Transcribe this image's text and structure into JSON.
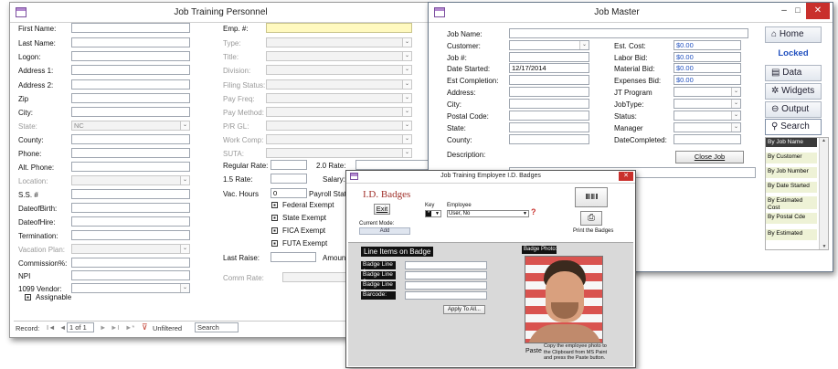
{
  "personnel": {
    "title": "Job Training Personnel",
    "left_labels": [
      "First Name:",
      "Last Name:",
      "Logon:",
      "Address 1:",
      "Address 2:",
      "Zip",
      "City:",
      "State:",
      "County:",
      "Phone:",
      "Alt. Phone:",
      "Location:",
      "S.S. #",
      "DateofBirth:",
      "DateofHire:",
      "Termination:",
      "Vacation Plan:",
      "Commission%:",
      "NPI",
      "1099 Vendor:"
    ],
    "state_value": "NC",
    "assignable_label": "Assignable",
    "mid_labels": [
      "Emp. #:",
      "Type:",
      "Title:",
      "Division:",
      "Filing Status:",
      "Pay Freq:",
      "Pay Method:",
      "P/R GL:",
      "Work Comp:",
      "SUTA:"
    ],
    "regular_rate": "Regular Rate:",
    "rate_20": "2.0 Rate:",
    "rate_15": "1.5 Rate:",
    "salary": "Salary:",
    "vac_hours": "Vac. Hours",
    "vac_value": "0",
    "payroll_status": "Payroll Status",
    "federal_exempt": "Federal Exempt",
    "state_exempt": "State Exempt",
    "fica_exempt": "FICA Exempt",
    "futa_exempt": "FUTA Exempt",
    "last_raise": "Last Raise:",
    "amount": "Amount",
    "comm_rate": "Comm Rate:",
    "record_label": "Record:",
    "record_value": "1 of 1",
    "unfiltered": "Unfiltered",
    "search": "Search"
  },
  "job_master": {
    "title": "Job Master",
    "left_labels": [
      "Job Name:",
      "Customer:",
      "Job #:",
      "Date Started:",
      "Est Completion:",
      "Address:",
      "City:",
      "Postal Code:",
      "State:",
      "County:",
      "Description:"
    ],
    "date_started": "12/17/2014",
    "right_labels": [
      "Est. Cost:",
      "Labor Bid:",
      "Material Bid:",
      "Expenses Bid:",
      "JT Program",
      "JobType:",
      "Status:",
      "Manager",
      "DateCompleted:"
    ],
    "money": [
      "$0.00",
      "$0.00",
      "$0.00",
      "$0.00"
    ],
    "close_job": "Close Job",
    "nav": {
      "home": "Home",
      "locked": "Locked",
      "data": "Data",
      "widgets": "Widgets",
      "output": "Output",
      "search": "Search"
    },
    "list": [
      "By Job Name",
      "By Customer",
      "By Job Number",
      "By Date Started",
      "By Estimated Cost",
      "By Postal Cde",
      "By Estimated"
    ]
  },
  "badges": {
    "title": "Job Training Employee I.D. Badges",
    "heading": "I.D. Badges",
    "exit": "Exit",
    "key_label": "Key",
    "key_value": "*",
    "employee_label": "Employee",
    "employee_value": "User, No",
    "current_mode_label": "Current Mode:",
    "current_mode_value": "Add",
    "print_label": "Print the Badges",
    "line_items": "Line Items on Badge",
    "badge_lines": [
      "Badge Line 1:",
      "Badge Line 2:",
      "Badge Line 3:",
      "Barcode:"
    ],
    "apply": "Apply To All...",
    "photo_label": "Badge Photo:",
    "paste": "Paste",
    "photo_instructions": "Copy the employee photo to the Clipboard from MS Paint and press the Paste button.",
    "barcode_icon": "IIII III II"
  },
  "colors": {
    "title_red": "#c9302c",
    "locked_blue": "#1f4fbf",
    "list_green": "#eef2d6"
  }
}
